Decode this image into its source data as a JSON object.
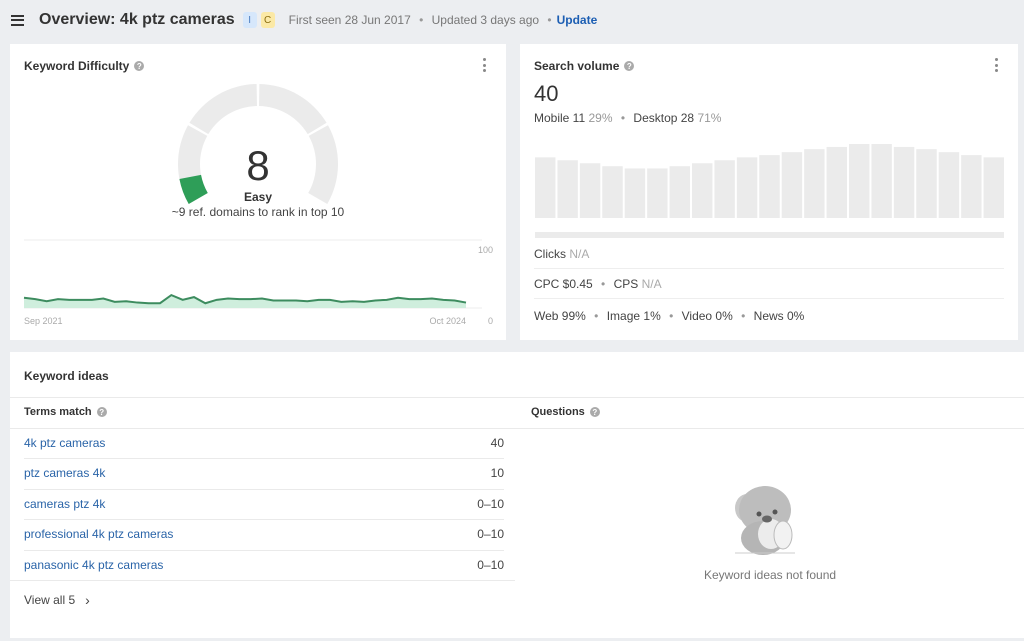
{
  "header": {
    "title": "Overview: 4k ptz cameras",
    "badges": [
      "I",
      "C"
    ],
    "first_seen": "First seen 28 Jun 2017",
    "updated": "Updated 3 days ago",
    "update_link": "Update",
    "separator": "•"
  },
  "keyword_difficulty": {
    "title": "Keyword Difficulty",
    "help": "?",
    "score": "8",
    "score_value": 8,
    "label": "Easy",
    "subtext": "~9 ref. domains to rank in top 10",
    "accent_color": "#2e9e58",
    "history": {
      "x_start_label": "Sep 2021",
      "x_end_label": "Oct 2024",
      "y_max_label": "100",
      "y_min_label": "0",
      "values": [
        15,
        13,
        10,
        13,
        12,
        12,
        12,
        14,
        9,
        10,
        8,
        7,
        7,
        19,
        12,
        16,
        7,
        12,
        14,
        13,
        13,
        14,
        11,
        11,
        11,
        10,
        12,
        12,
        9,
        10,
        9,
        11,
        12,
        15,
        13,
        13,
        14,
        12,
        11,
        8
      ]
    }
  },
  "search_volume": {
    "title": "Search volume",
    "help": "?",
    "value": "40",
    "mobile_label": "Mobile 11",
    "mobile_pct": "29%",
    "desktop_label": "Desktop 28",
    "desktop_pct": "71%",
    "trend_relative": [
      0.82,
      0.78,
      0.74,
      0.7,
      0.67,
      0.67,
      0.7,
      0.74,
      0.78,
      0.82,
      0.85,
      0.89,
      0.93,
      0.96,
      1.0,
      1.0,
      0.96,
      0.93,
      0.89,
      0.85,
      0.82
    ],
    "clicks_label": "Clicks",
    "clicks_value": "N/A",
    "cpc_label": "CPC $0.45",
    "cps_label": "CPS",
    "cps_value": "N/A",
    "serp_mix": [
      "Web 99%",
      "Image 1%",
      "Video 0%",
      "News 0%"
    ]
  },
  "keyword_ideas": {
    "title": "Keyword ideas",
    "terms_match": {
      "title": "Terms match",
      "rows": [
        {
          "keyword": "4k ptz cameras",
          "volume": "40"
        },
        {
          "keyword": "ptz cameras 4k",
          "volume": "10"
        },
        {
          "keyword": "cameras ptz 4k",
          "volume": "0–10"
        },
        {
          "keyword": "professional 4k ptz cameras",
          "volume": "0–10"
        },
        {
          "keyword": "panasonic 4k ptz cameras",
          "volume": "0–10"
        }
      ],
      "view_all": "View all 5"
    },
    "questions": {
      "title": "Questions",
      "empty_text": "Keyword ideas not found"
    }
  }
}
